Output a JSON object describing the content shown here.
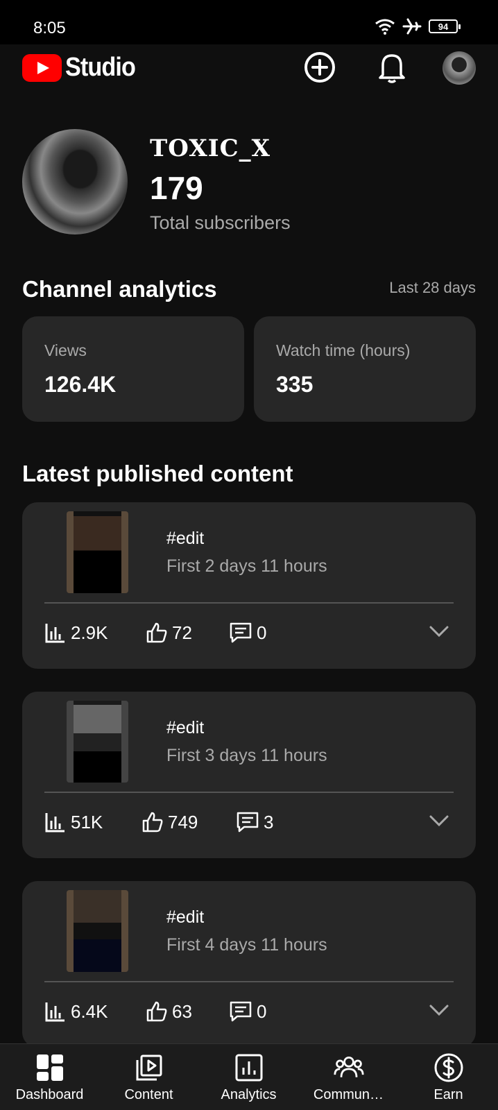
{
  "status_bar": {
    "time": "8:05",
    "battery": "94"
  },
  "header": {
    "app_name": "Studio"
  },
  "channel": {
    "name": "TOXIC_X",
    "subscribers": "179",
    "subscribers_label": "Total subscribers"
  },
  "analytics": {
    "title": "Channel analytics",
    "range": "Last 28 days",
    "views_label": "Views",
    "views_value": "126.4K",
    "watch_label": "Watch time (hours)",
    "watch_value": "335"
  },
  "latest": {
    "title": "Latest published content",
    "items": [
      {
        "title": "#edit",
        "subtitle": "First 2 days 11 hours",
        "views": "2.9K",
        "likes": "72",
        "comments": "0"
      },
      {
        "title": "#edit",
        "subtitle": "First 3 days 11 hours",
        "views": "51K",
        "likes": "749",
        "comments": "3"
      },
      {
        "title": "#edit",
        "subtitle": "First 4 days 11 hours",
        "views": "6.4K",
        "likes": "63",
        "comments": "0"
      }
    ]
  },
  "nav": {
    "dashboard": "Dashboard",
    "content": "Content",
    "analytics": "Analytics",
    "community": "Commun…",
    "earn": "Earn"
  }
}
